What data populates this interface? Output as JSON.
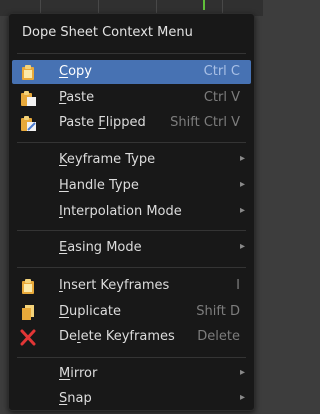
{
  "menu": {
    "title": "Dope Sheet Context Menu",
    "items": {
      "copy": {
        "label_u": "C",
        "label_rest": "opy",
        "shortcut": "Ctrl C",
        "icon": "copy-clipboard-icon"
      },
      "paste": {
        "label_u": "P",
        "label_rest": "aste",
        "shortcut": "Ctrl V",
        "icon": "paste-clipboard-icon"
      },
      "paste_flipped": {
        "label_pre": "Paste ",
        "label_u": "F",
        "label_rest": "lipped",
        "shortcut": "Shift Ctrl V",
        "icon": "paste-flipped-icon"
      },
      "keyframe_type": {
        "label_u": "K",
        "label_rest": "eyframe Type"
      },
      "handle_type": {
        "label_u": "H",
        "label_rest": "andle Type"
      },
      "interpolation_mode": {
        "label_u": "I",
        "label_rest": "nterpolation Mode"
      },
      "easing_mode": {
        "label_u": "E",
        "label_rest": "asing Mode"
      },
      "insert_keyframes": {
        "label_u": "I",
        "label_rest": "nsert Keyframes",
        "shortcut": "I",
        "icon": "insert-keyframes-icon"
      },
      "duplicate": {
        "label_u": "D",
        "label_rest": "uplicate",
        "shortcut": "Shift D",
        "icon": "duplicate-icon"
      },
      "delete_keyframes": {
        "label_pre": "De",
        "label_u": "l",
        "label_rest": "ete Keyframes",
        "shortcut": "Delete",
        "icon": "delete-x-icon"
      },
      "mirror": {
        "label_u": "M",
        "label_rest": "irror"
      },
      "snap": {
        "label_u": "S",
        "label_rest": "nap"
      }
    },
    "submenu_arrow": "▸"
  },
  "colors": {
    "menu_bg": "#181818",
    "highlight": "#4772b3",
    "shortcut_text": "#7d7d7d",
    "icon_yellow": "#f2c14e",
    "icon_red": "#e23636"
  }
}
